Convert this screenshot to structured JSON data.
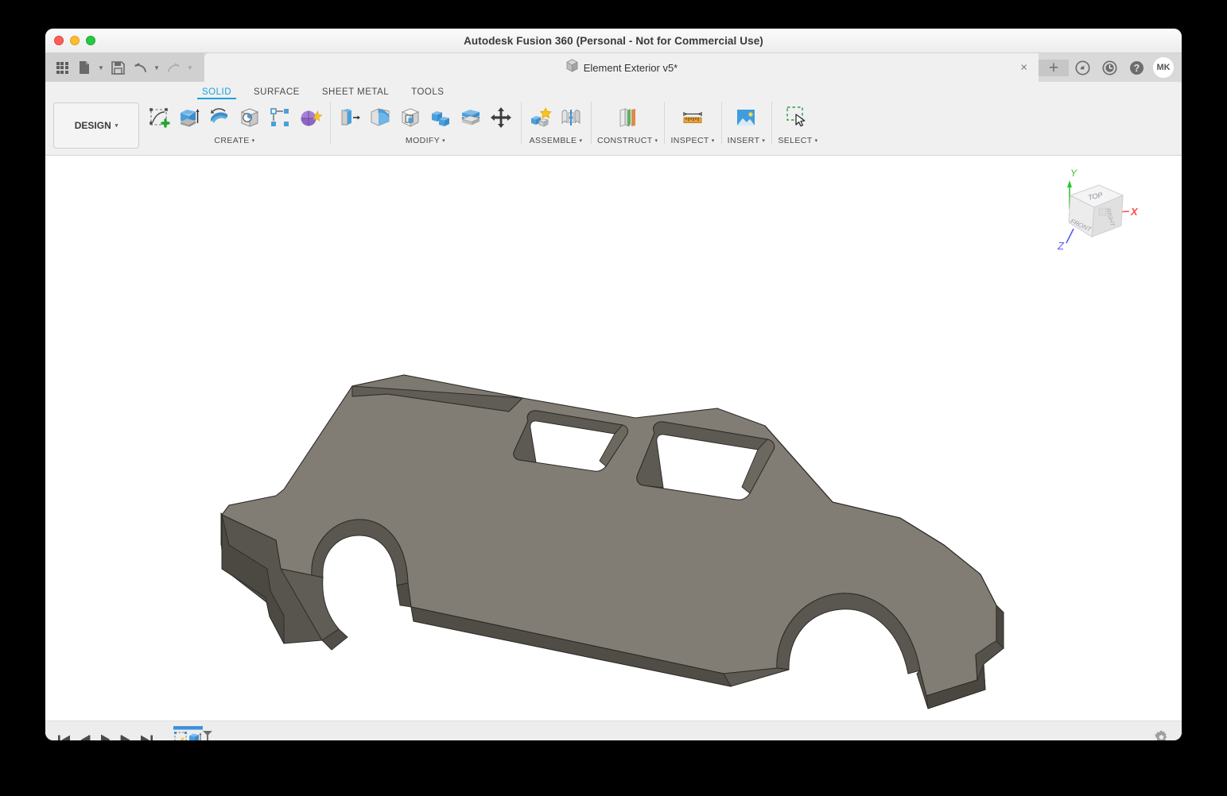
{
  "window": {
    "title": "Autodesk Fusion 360 (Personal - Not for Commercial Use)",
    "traffic_lights": [
      "close",
      "minimize",
      "maximize"
    ]
  },
  "quick_access": {
    "items": [
      {
        "name": "app-grid",
        "icon": "grid-icon"
      },
      {
        "name": "new-file",
        "icon": "file-icon",
        "has_caret": true
      },
      {
        "name": "save",
        "icon": "save-icon"
      },
      {
        "name": "undo",
        "icon": "undo-icon",
        "has_caret": true,
        "enabled": true
      },
      {
        "name": "redo",
        "icon": "redo-icon",
        "has_caret": true,
        "enabled": false
      }
    ]
  },
  "document_tab": {
    "label": "Element Exterior v5*",
    "icon": "cube-icon",
    "close_label": "×"
  },
  "tab_actions": {
    "new_tab_label": "+",
    "icons": [
      "speedometer-icon",
      "recent-clock-icon",
      "help-icon"
    ],
    "avatar_initials": "MK"
  },
  "ribbon_tabs": [
    {
      "label": "SOLID",
      "active": true
    },
    {
      "label": "SURFACE",
      "active": false
    },
    {
      "label": "SHEET METAL",
      "active": false
    },
    {
      "label": "TOOLS",
      "active": false
    }
  ],
  "workspace_selector": {
    "label": "DESIGN",
    "caret": "▾"
  },
  "ribbon_groups": [
    {
      "label": "CREATE",
      "caret": "▾",
      "tools": [
        "create-sketch-icon",
        "extrude-icon",
        "revolve-icon",
        "sweep-icon",
        "pattern-icon",
        "create-form-icon"
      ]
    },
    {
      "label": "MODIFY",
      "caret": "▾",
      "tools": [
        "press-pull-icon",
        "fillet-icon",
        "shell-icon",
        "combine-icon",
        "split-face-icon",
        "move-copy-icon"
      ]
    },
    {
      "label": "ASSEMBLE",
      "caret": "▾",
      "tools": [
        "new-component-icon",
        "joint-icon"
      ]
    },
    {
      "label": "CONSTRUCT",
      "caret": "▾",
      "tools": [
        "offset-plane-icon"
      ]
    },
    {
      "label": "INSPECT",
      "caret": "▾",
      "tools": [
        "measure-icon"
      ]
    },
    {
      "label": "INSERT",
      "caret": "▾",
      "tools": [
        "insert-image-icon"
      ]
    },
    {
      "label": "SELECT",
      "caret": "▾",
      "tools": [
        "window-select-icon"
      ]
    }
  ],
  "viewcube": {
    "faces": {
      "top": "TOP",
      "front": "FRONT",
      "right": "RIGHT"
    },
    "axes": [
      {
        "label": "Y",
        "color": "#2fc42f"
      },
      {
        "label": "X",
        "color": "#ff4444"
      },
      {
        "label": "Z",
        "color": "#4a4aff"
      }
    ]
  },
  "model": {
    "name": "car-body-extrusion",
    "top_face_color": "#817d74",
    "side_face_color": "#504d47",
    "edge_color": "#2e2c28",
    "background_color": "#ffffff"
  },
  "timeline": {
    "controls": [
      {
        "name": "go-to-beginning",
        "glyph": "skip-back-icon"
      },
      {
        "name": "step-back",
        "glyph": "step-back-icon"
      },
      {
        "name": "play",
        "glyph": "play-icon"
      },
      {
        "name": "step-forward",
        "glyph": "step-forward-icon"
      },
      {
        "name": "go-to-end",
        "glyph": "skip-end-icon"
      }
    ],
    "features": [
      {
        "name": "sketch-feature",
        "icon": "sketch-icon"
      },
      {
        "name": "extrude-feature",
        "icon": "extrude-icon"
      }
    ],
    "settings_icon": "gear-icon"
  }
}
